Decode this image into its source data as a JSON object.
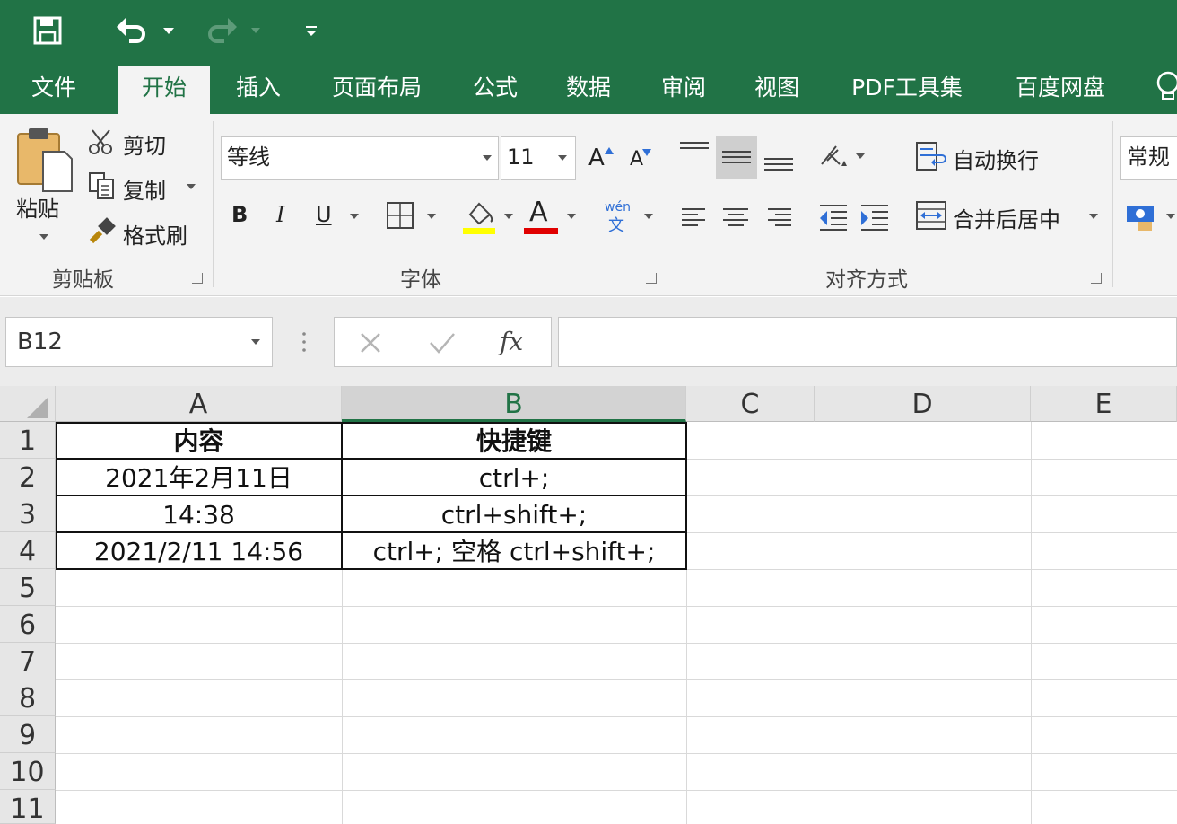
{
  "qat": {
    "save_icon": "save-icon",
    "undo_icon": "undo-icon",
    "redo_icon": "redo-icon",
    "customize_icon": "customize-qat-icon"
  },
  "tabs": [
    {
      "label": "文件"
    },
    {
      "label": "开始"
    },
    {
      "label": "插入"
    },
    {
      "label": "页面布局"
    },
    {
      "label": "公式"
    },
    {
      "label": "数据"
    },
    {
      "label": "审阅"
    },
    {
      "label": "视图"
    },
    {
      "label": "PDF工具集"
    },
    {
      "label": "百度网盘"
    }
  ],
  "active_tab": "开始",
  "ribbon": {
    "clipboard": {
      "paste_label": "粘贴",
      "cut_label": "剪切",
      "copy_label": "复制",
      "format_painter_label": "格式刷",
      "group_label": "剪贴板"
    },
    "font": {
      "font_name": "等线",
      "font_size": "11",
      "bold": "B",
      "italic": "I",
      "underline": "U",
      "font_color_glyph": "A",
      "increase_glyph": "A",
      "decrease_glyph": "A",
      "phonetic_top": "wén",
      "phonetic_bottom": "文",
      "highlight_color": "#ffff00",
      "font_color": "#e00000",
      "group_label": "字体"
    },
    "alignment": {
      "wrap_text_label": "自动换行",
      "merge_center_label": "合并后居中",
      "group_label": "对齐方式"
    },
    "number": {
      "format_value": "常规"
    }
  },
  "formula_bar": {
    "name_box": "B12",
    "fx_label": "fx",
    "formula_value": ""
  },
  "sheet": {
    "columns": [
      "A",
      "B",
      "C",
      "D",
      "E"
    ],
    "selected_column": "B",
    "rows": [
      "1",
      "2",
      "3",
      "4",
      "5",
      "6",
      "7",
      "8",
      "9",
      "10",
      "11"
    ],
    "table": {
      "headers": [
        "内容",
        "快捷键"
      ],
      "rows": [
        [
          "2021年2月11日",
          "ctrl+;"
        ],
        [
          "14:38",
          "ctrl+shift+;"
        ],
        [
          "2021/2/11 14:56",
          "ctrl+; 空格 ctrl+shift+;"
        ]
      ]
    }
  },
  "colors": {
    "brand_green": "#217346",
    "ribbon_bg": "#f3f3f3"
  }
}
